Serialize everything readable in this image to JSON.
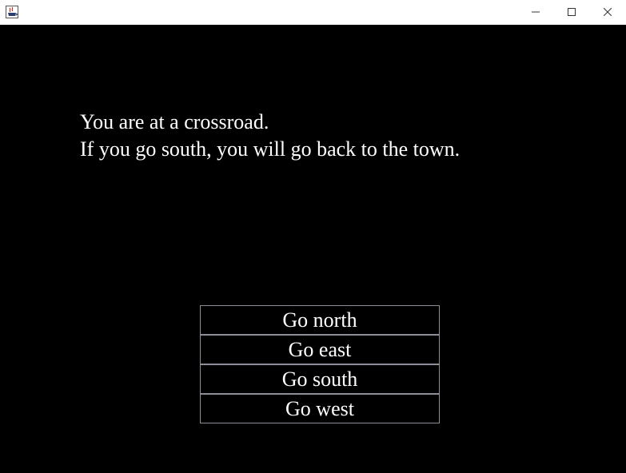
{
  "window": {
    "icons": {
      "app": "java-coffee-cup-icon",
      "minimize": "minimize-icon",
      "maximize": "maximize-icon",
      "close": "close-icon"
    }
  },
  "story": {
    "lines": [
      "You are at a crossroad.",
      "If you go south, you will go back to the town."
    ]
  },
  "choices": [
    {
      "label": "Go north"
    },
    {
      "label": "Go east"
    },
    {
      "label": "Go south"
    },
    {
      "label": "Go west"
    }
  ],
  "colors": {
    "background": "#000000",
    "text": "#ffffff",
    "button_border": "#8a8f98"
  }
}
